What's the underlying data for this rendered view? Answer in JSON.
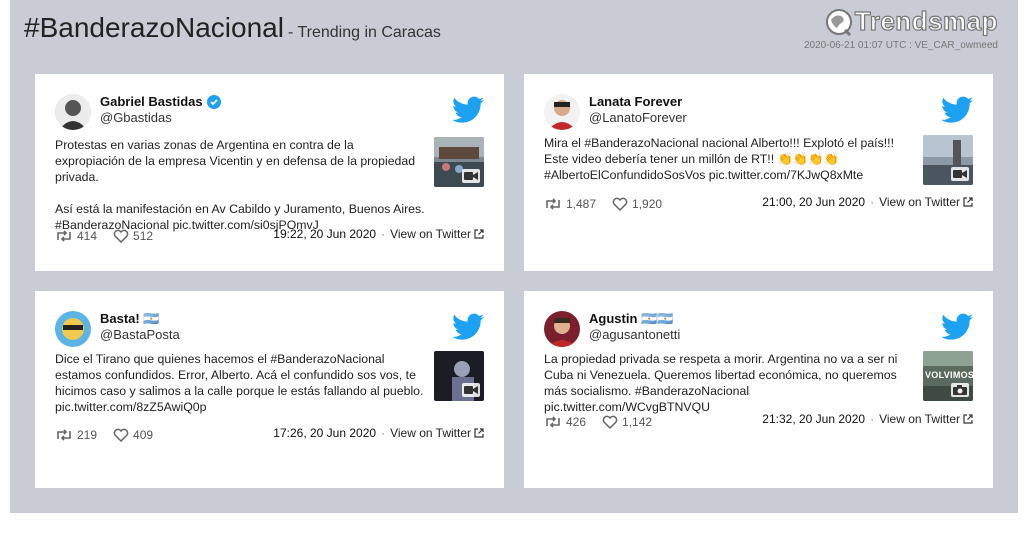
{
  "header": {
    "hashtag": "#BanderazoNacional",
    "subtitle": "- Trending in Caracas",
    "logo_text": "Trendsmap",
    "timestamp": "2020-06-21 01:07 UTC : VE_CAR_owmeed"
  },
  "colors": {
    "twitter_blue": "#1da1f2",
    "verified": "#1da1f2",
    "frame": "#c9ccd4"
  },
  "tweets": [
    {
      "name": "Gabriel Bastidas",
      "verified": true,
      "handle": "@Gbastidas",
      "text1": "Protestas en varias zonas de Argentina en contra de la expropiación de la empresa Vicentin y en defensa de la propiedad privada.",
      "text2": "Así está la manifestación en Av Cabildo y Juramento, Buenos Aires. #BanderazoNacional pic.twitter.com/si0sjPOmvJ",
      "retweets": "414",
      "likes": "512",
      "datetime": "19:22, 20 Jun 2020",
      "view_label": "View on Twitter",
      "media_icon": "video-camera-icon"
    },
    {
      "name": "Lanata Forever",
      "verified": false,
      "handle": "@LanatoForever",
      "text1": "Mira el #BanderazoNacional nacional Alberto!!! Explotó el país!!! Este video debería tener un millón de RT!! 👏👏👏👏 #AlbertoElConfundidoSosVos pic.twitter.com/7KJwQ8xMte",
      "retweets": "1,487",
      "likes": "1,920",
      "datetime": "21:00, 20 Jun 2020",
      "view_label": "View on Twitter",
      "media_icon": "video-camera-icon"
    },
    {
      "name": "Basta! 🇦🇷",
      "verified": false,
      "handle": "@BastaPosta",
      "text1": "Dice el Tirano que quienes hacemos el #BanderazoNacional estamos confundidos. Error, Alberto. Acá el confundido sos vos, te hicimos caso y salimos a la calle porque le estás fallando al pueblo. pic.twitter.com/8zZ5AwiQ0p",
      "retweets": "219",
      "likes": "409",
      "datetime": "17:26, 20 Jun 2020",
      "view_label": "View on Twitter",
      "media_icon": "video-camera-icon"
    },
    {
      "name": "Agustin 🇦🇷🇦🇷",
      "verified": false,
      "handle": "@agusantonetti",
      "text1": "La propiedad privada se respeta a morir. Argentina no va a ser ni Cuba ni Venezuela. Queremos libertad económica, no queremos más socialismo. #BanderazoNacional pic.twitter.com/WCvgBTNVQU",
      "thumb_text": "VOLVIMOS",
      "retweets": "426",
      "likes": "1,142",
      "datetime": "21:32, 20 Jun 2020",
      "view_label": "View on Twitter",
      "media_icon": "photo-camera-icon"
    }
  ]
}
